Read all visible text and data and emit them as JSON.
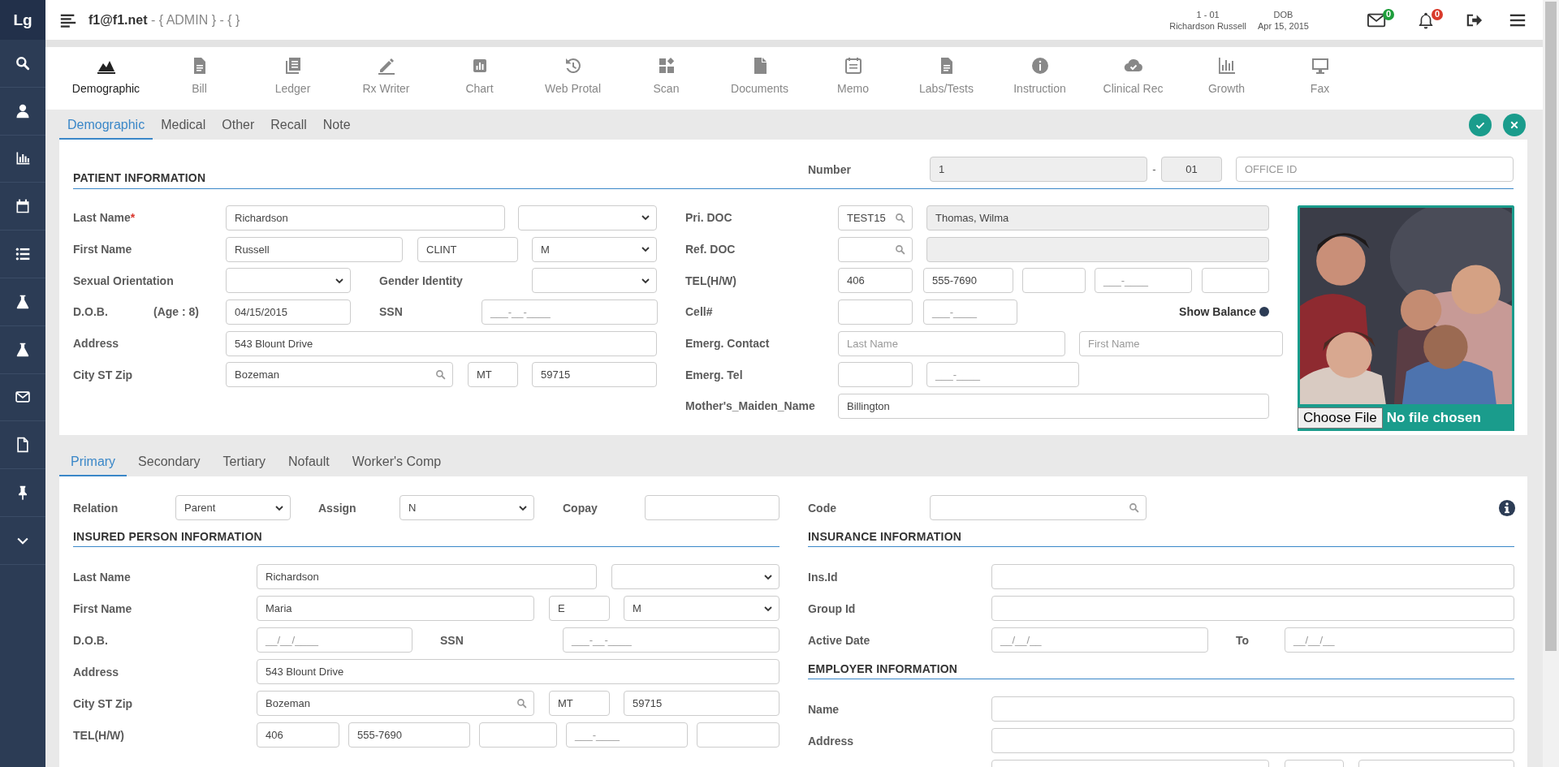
{
  "app": {
    "logo": "Lg",
    "account": "f1@f1.net",
    "context": " - { ADMIN } - { }"
  },
  "patient_badge": {
    "number": "1 - 01",
    "name": "Richardson Russell",
    "dob_label": "DOB",
    "dob": "Apr 15, 2015"
  },
  "notifications": {
    "messages": "0",
    "alerts": "0"
  },
  "toolbar": [
    {
      "label": "Demographic",
      "selected": true
    },
    {
      "label": "Bill",
      "selected": false
    },
    {
      "label": "Ledger",
      "selected": false
    },
    {
      "label": "Rx Writer",
      "selected": false
    },
    {
      "label": "Chart",
      "selected": false
    },
    {
      "label": "Web Protal",
      "selected": false
    },
    {
      "label": "Scan",
      "selected": false
    },
    {
      "label": "Documents",
      "selected": false
    },
    {
      "label": "Memo",
      "selected": false
    },
    {
      "label": "Labs/Tests",
      "selected": false
    },
    {
      "label": "Instruction",
      "selected": false
    },
    {
      "label": "Clinical Rec",
      "selected": false
    },
    {
      "label": "Growth",
      "selected": false
    },
    {
      "label": "Fax",
      "selected": false
    }
  ],
  "tabs": [
    {
      "label": "Demographic",
      "selected": true
    },
    {
      "label": "Medical",
      "selected": false
    },
    {
      "label": "Other",
      "selected": false
    },
    {
      "label": "Recall",
      "selected": false
    },
    {
      "label": "Note",
      "selected": false
    }
  ],
  "patient_information": {
    "title": "PATIENT INFORMATION",
    "number": {
      "label": "Number",
      "value": "1",
      "separator": "-",
      "suffix": "01",
      "office_placeholder": "OFFICE ID"
    },
    "left": [
      {
        "label": "Last Name",
        "required_mark": "*",
        "fields": [
          {
            "kind": "input",
            "value": "Richardson"
          },
          {
            "kind": "select"
          }
        ]
      },
      {
        "label": "First Name",
        "fields": [
          {
            "kind": "input",
            "value": "Russell"
          },
          {
            "kind": "input",
            "value": "CLINT"
          },
          {
            "kind": "select",
            "value": "M"
          }
        ]
      },
      {
        "label": "Sexual Orientation",
        "fields": [
          {
            "kind": "select"
          },
          {
            "kind": "label",
            "text": "Gender Identity"
          },
          {
            "kind": "select"
          }
        ]
      },
      {
        "label": "D.O.B.",
        "note": "(Age : 8)",
        "fields": [
          {
            "kind": "input",
            "value": "04/15/2015"
          },
          {
            "kind": "label",
            "text": "SSN"
          },
          {
            "kind": "input",
            "placeholder": "___-__-____"
          }
        ]
      },
      {
        "label": "Address",
        "fields": [
          {
            "kind": "input",
            "value": "543 Blount Drive"
          }
        ]
      },
      {
        "label": "City ST Zip",
        "fields": [
          {
            "kind": "search",
            "value": "Bozeman"
          },
          {
            "kind": "input",
            "value": "MT"
          },
          {
            "kind": "input",
            "value": "59715"
          }
        ]
      }
    ],
    "right": [
      {
        "label": "Pri. DOC",
        "fields": [
          {
            "kind": "search",
            "value": "TEST15"
          },
          {
            "kind": "readonly",
            "value": "Thomas, Wilma"
          }
        ]
      },
      {
        "label": "Ref. DOC",
        "fields": [
          {
            "kind": "search"
          },
          {
            "kind": "readonly"
          }
        ]
      },
      {
        "label": "TEL(H/W)",
        "fields": [
          {
            "kind": "input",
            "value": "406"
          },
          {
            "kind": "input",
            "value": "555-7690"
          },
          {
            "kind": "input"
          },
          {
            "kind": "input",
            "placeholder": "___-____"
          },
          {
            "kind": "input"
          }
        ]
      },
      {
        "label": "Cell#",
        "fields": [
          {
            "kind": "input"
          },
          {
            "kind": "input",
            "placeholder": "___-____"
          },
          {
            "kind": "balance",
            "text": "Show Balance"
          }
        ]
      },
      {
        "label": "Emerg. Contact",
        "fields": [
          {
            "kind": "input",
            "placeholder": "Last Name"
          },
          {
            "kind": "input",
            "placeholder": "First Name"
          }
        ]
      },
      {
        "label": "Emerg. Tel",
        "fields": [
          {
            "kind": "input"
          },
          {
            "kind": "input",
            "placeholder": "___-____"
          }
        ]
      },
      {
        "label": "Mother's_Maiden_Name",
        "fields": [
          {
            "kind": "input",
            "value": "Billington"
          }
        ]
      }
    ],
    "photo": {
      "kind": "picture",
      "button": "Choose File",
      "status": "No file chosen"
    }
  },
  "insurance_tabs": [
    {
      "label": "Primary",
      "selected": true
    },
    {
      "label": "Secondary",
      "selected": false
    },
    {
      "label": "Tertiary",
      "selected": false
    },
    {
      "label": "Nofault",
      "selected": false
    },
    {
      "label": "Worker's Comp",
      "selected": false
    }
  ],
  "insurance": {
    "relation_row": {
      "label": "Relation",
      "fields": [
        {
          "kind": "select",
          "value": "Parent"
        },
        {
          "kind": "label",
          "text": "Assign"
        },
        {
          "kind": "select",
          "value": "N"
        },
        {
          "kind": "label",
          "text": "Copay"
        },
        {
          "kind": "input"
        }
      ]
    },
    "code_row": {
      "label": "Code",
      "fields": [
        {
          "kind": "search"
        }
      ]
    },
    "insured": {
      "title": "INSURED PERSON INFORMATION",
      "rows": [
        {
          "label": "Last Name",
          "fields": [
            {
              "kind": "input",
              "value": "Richardson"
            },
            {
              "kind": "select"
            }
          ]
        },
        {
          "label": "First Name",
          "fields": [
            {
              "kind": "input",
              "value": "Maria"
            },
            {
              "kind": "input",
              "value": "E"
            },
            {
              "kind": "select",
              "value": "M"
            }
          ]
        },
        {
          "label": "D.O.B.",
          "fields": [
            {
              "kind": "input",
              "placeholder": "__/__/____"
            },
            {
              "kind": "label",
              "text": "SSN"
            },
            {
              "kind": "input",
              "placeholder": "___-__-____"
            }
          ]
        },
        {
          "label": "Address",
          "fields": [
            {
              "kind": "input",
              "value": "543 Blount Drive"
            }
          ]
        },
        {
          "label": "City ST Zip",
          "fields": [
            {
              "kind": "search",
              "value": "Bozeman"
            },
            {
              "kind": "input",
              "value": "MT"
            },
            {
              "kind": "input",
              "value": "59715"
            }
          ]
        },
        {
          "label": "TEL(H/W)",
          "fields": [
            {
              "kind": "input",
              "value": "406"
            },
            {
              "kind": "input",
              "value": "555-7690"
            },
            {
              "kind": "input"
            },
            {
              "kind": "input",
              "placeholder": "___-____"
            },
            {
              "kind": "input"
            }
          ]
        }
      ]
    },
    "insurance_info": {
      "title": "INSURANCE INFORMATION",
      "rows": [
        {
          "label": "Ins.Id",
          "fields": [
            {
              "kind": "input"
            }
          ]
        },
        {
          "label": "Group Id",
          "fields": [
            {
              "kind": "input"
            }
          ]
        },
        {
          "label": "Active Date",
          "fields": [
            {
              "kind": "input",
              "placeholder": "__/__/__"
            },
            {
              "kind": "label",
              "text": "To"
            },
            {
              "kind": "input",
              "placeholder": "__/__/__"
            }
          ]
        }
      ]
    },
    "employer": {
      "title": "EMPLOYER INFORMATION",
      "rows": [
        {
          "label": "Name",
          "fields": [
            {
              "kind": "input"
            }
          ]
        },
        {
          "label": "Address",
          "fields": [
            {
              "kind": "input"
            }
          ]
        },
        {
          "fields": [
            {
              "kind": "input"
            },
            {
              "kind": "input"
            },
            {
              "kind": "input"
            }
          ]
        }
      ]
    }
  }
}
